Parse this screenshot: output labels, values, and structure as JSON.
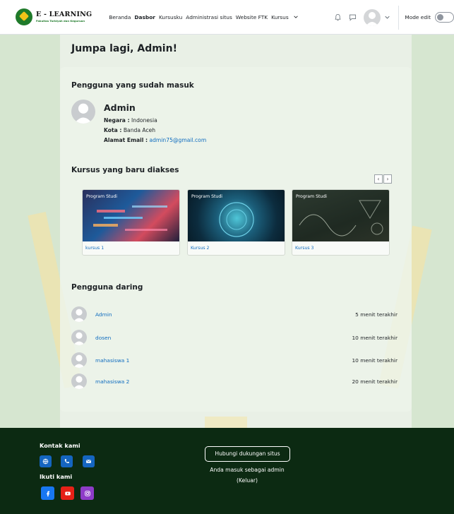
{
  "navbar": {
    "logo_title": "E - LEARNING",
    "logo_subtitle": "Fakultas Tarbiyah dan Keguruan",
    "links": [
      "Beranda",
      "Dasbor",
      "Kursusku",
      "Administrasi situs",
      "Website FTK",
      "Kursus"
    ],
    "active_link": "Dasbor",
    "edit_mode_label": "Mode edit",
    "edit_mode_on": false
  },
  "greeting": "Jumpa lagi, Admin!",
  "logged_in_block": {
    "title": "Pengguna yang sudah masuk",
    "name": "Admin",
    "country_label": "Negara :",
    "country": "Indonesia",
    "city_label": "Kota :",
    "city": "Banda Aceh",
    "email_label": "Alamat Email :",
    "email": "admin75@gmail.com"
  },
  "recent_courses": {
    "title": "Kursus yang baru diakses",
    "items": [
      {
        "category": "Program Studi",
        "name": "kursus 1"
      },
      {
        "category": "Program Studi",
        "name": "Kursus 2"
      },
      {
        "category": "Program Studi",
        "name": "Kursus 3"
      }
    ],
    "prev_label": "‹",
    "next_label": "›"
  },
  "online_users": {
    "title": "Pengguna daring",
    "items": [
      {
        "name": "Admin",
        "time": "5 menit terakhir"
      },
      {
        "name": "dosen",
        "time": "10 menit terakhir"
      },
      {
        "name": "mahasiswa 1",
        "time": "10 menit terakhir"
      },
      {
        "name": "mahasiswa 2",
        "time": "20 menit terakhir"
      }
    ]
  },
  "footer": {
    "contact_title": "Kontak kami",
    "follow_title": "Ikuti kami",
    "support_button": "Hubungi dukungan situs",
    "logged_in_as": "Anda masuk sebagai admin",
    "logout": "(Keluar)",
    "colors": {
      "contact_icons": "#1565c0",
      "facebook": "#1877f2",
      "youtube": "#e62117",
      "instagram": "#8e3cc8"
    }
  }
}
